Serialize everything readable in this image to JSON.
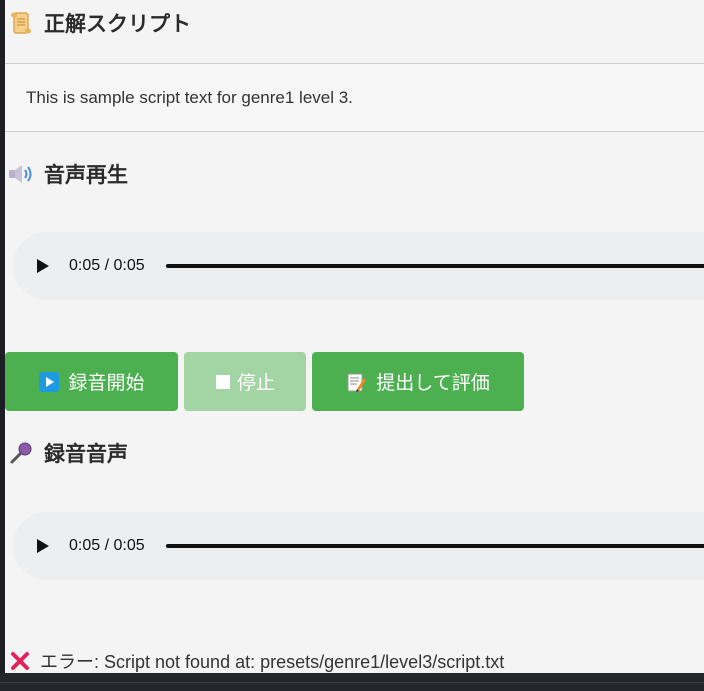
{
  "script_section": {
    "icon": "scroll-icon",
    "title": "正解スクリプト",
    "text": "This is sample script text for genre1 level 3."
  },
  "playback_section": {
    "icon": "speaker-icon",
    "title": "音声再生",
    "player": {
      "time": "0:05 / 0:05",
      "progress": 1.0
    }
  },
  "controls": {
    "record_label": "録音開始",
    "record_icon": "play-square-icon",
    "stop_label": "停止",
    "stop_icon": "stop-square-icon",
    "stop_disabled": true,
    "submit_label": "提出して評価",
    "submit_icon": "memo-pencil-icon"
  },
  "recording_section": {
    "icon": "microphone-icon",
    "title": "録音音声",
    "player": {
      "time": "0:05 / 0:05",
      "progress": 1.0
    }
  },
  "error": {
    "icon": "cross-mark-icon",
    "text": "エラー: Script not found at: presets/genre1/level3/script.txt"
  },
  "colors": {
    "button_green": "#4caf50",
    "button_disabled": "#a3d4a3",
    "error_red": "#e0245e"
  }
}
